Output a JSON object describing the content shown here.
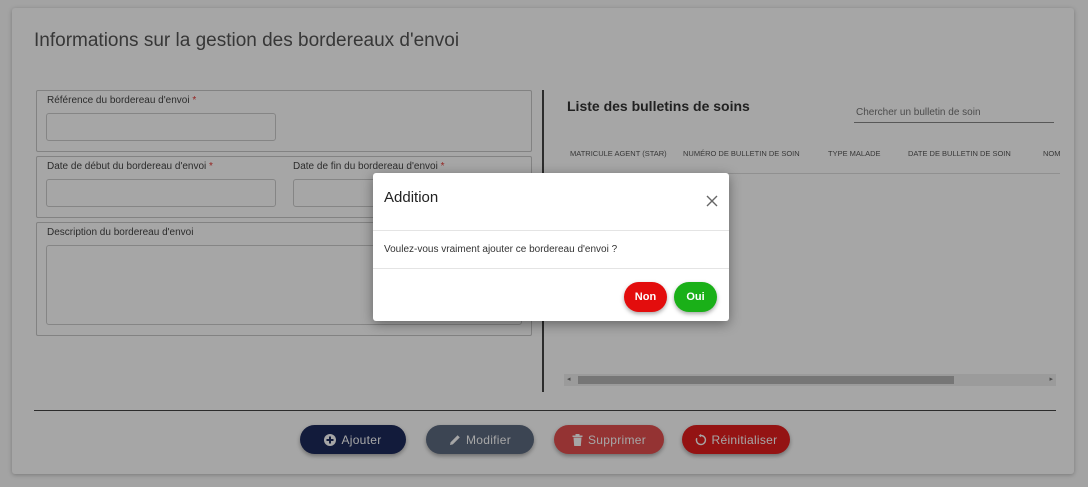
{
  "page": {
    "title": "Informations sur la gestion des bordereaux d'envoi"
  },
  "form": {
    "reference_label": "Référence du bordereau d'envoi",
    "date_debut_label": "Date de début du bordereau d'envoi",
    "date_fin_label": "Date de fin du bordereau d'envoi",
    "description_label": "Description du bordereau d'envoi",
    "required_mark": "*"
  },
  "list": {
    "title": "Liste des bulletins de soins",
    "search_placeholder": "Chercher un bulletin de soin",
    "columns": [
      "MATRICULE AGENT (STAR)",
      "NUMÉRO DE BULLETIN DE SOIN",
      "TYPE MALADE",
      "DATE DE BULLETIN DE SOIN",
      "NOM"
    ]
  },
  "actions": {
    "ajouter": "Ajouter",
    "modifier": "Modifier",
    "supprimer": "Supprimer",
    "reinitialiser": "Réinitialiser"
  },
  "modal": {
    "title": "Addition",
    "message": "Voulez-vous vraiment ajouter ce bordereau d'envoi ?",
    "non_label": "Non",
    "oui_label": "Oui"
  },
  "colors": {
    "ajouter": "#1d2a5b",
    "modifier": "#5d6b80",
    "supprimer": "#e44f4f",
    "reinitialiser": "#e41e1e",
    "non": "#e30d0d",
    "oui": "#1ab018",
    "required": "#e53935"
  },
  "icons": {
    "ajouter": "plus-circle-icon",
    "modifier": "pencil-icon",
    "supprimer": "trash-icon",
    "reinitialiser": "reset-icon",
    "modal_close": "close-icon"
  }
}
